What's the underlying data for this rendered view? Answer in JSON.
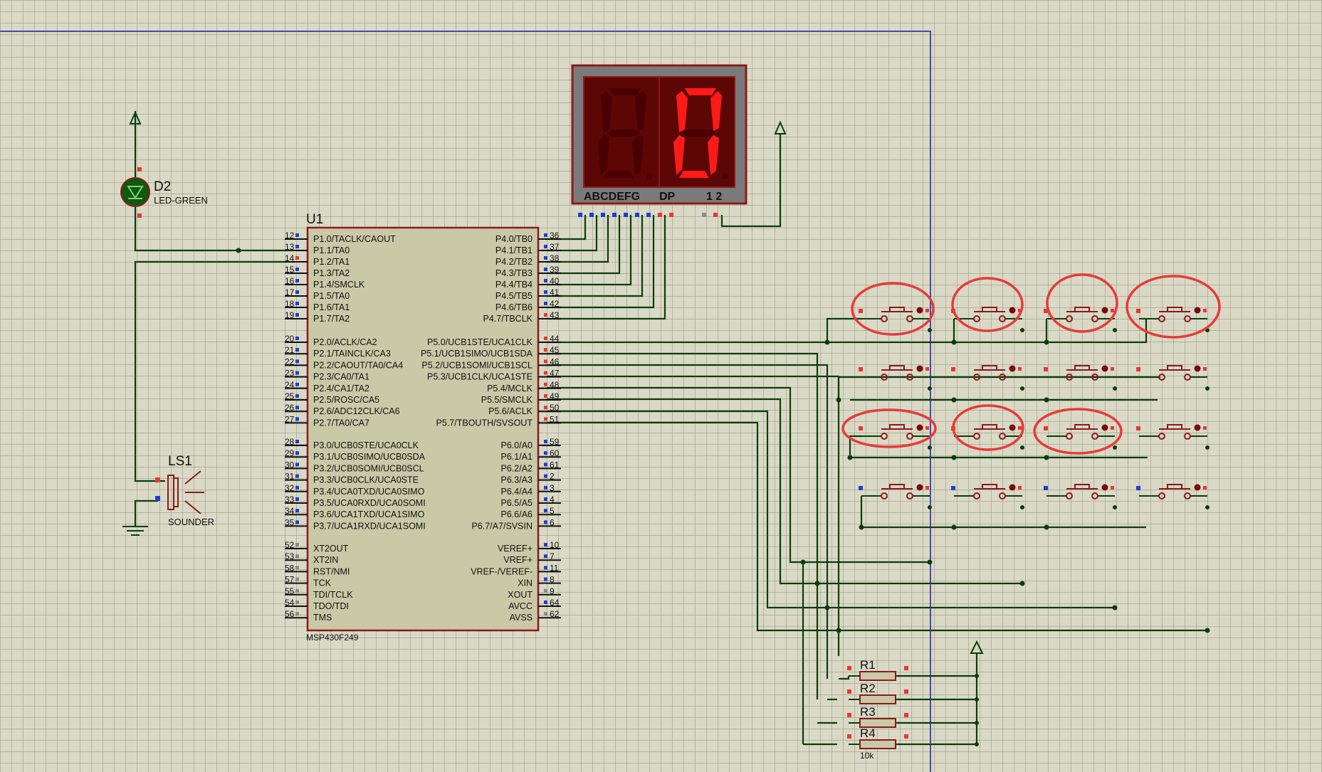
{
  "u1": {
    "ref": "U1",
    "part": "MSP430F249",
    "left_pins": [
      {
        "n": "12",
        "label": "P1.0/TACLK/CAOUT"
      },
      {
        "n": "13",
        "label": "P1.1/TA0"
      },
      {
        "n": "14",
        "label": "P1.2/TA1"
      },
      {
        "n": "15",
        "label": "P1.3/TA2"
      },
      {
        "n": "16",
        "label": "P1.4/SMCLK"
      },
      {
        "n": "17",
        "label": "P1.5/TA0"
      },
      {
        "n": "18",
        "label": "P1.6/TA1"
      },
      {
        "n": "19",
        "label": "P1.7/TA2"
      },
      {
        "n": "20",
        "label": "P2.0/ACLK/CA2"
      },
      {
        "n": "21",
        "label": "P2.1/TAINCLK/CA3"
      },
      {
        "n": "22",
        "label": "P2.2/CAOUT/TA0/CA4"
      },
      {
        "n": "23",
        "label": "P2.3/CA0/TA1"
      },
      {
        "n": "24",
        "label": "P2.4/CA1/TA2"
      },
      {
        "n": "25",
        "label": "P2.5/ROSC/CA5"
      },
      {
        "n": "26",
        "label": "P2.6/ADC12CLK/CA6"
      },
      {
        "n": "27",
        "label": "P2.7/TA0/CA7"
      },
      {
        "n": "28",
        "label": "P3.0/UCB0STE/UCA0CLK"
      },
      {
        "n": "29",
        "label": "P3.1/UCB0SIMO/UCB0SDA"
      },
      {
        "n": "30",
        "label": "P3.2/UCB0SOMI/UCB0SCL"
      },
      {
        "n": "31",
        "label": "P3.3/UCB0CLK/UCA0STE"
      },
      {
        "n": "32",
        "label": "P3.4/UCA0TXD/UCA0SIMO"
      },
      {
        "n": "33",
        "label": "P3.5/UCA0RXD/UCA0SOMI"
      },
      {
        "n": "34",
        "label": "P3.6/UCA1TXD/UCA1SIMO"
      },
      {
        "n": "35",
        "label": "P3.7/UCA1RXD/UCA1SOMI"
      },
      {
        "n": "52",
        "label": "XT2OUT"
      },
      {
        "n": "53",
        "label": "XT2IN"
      },
      {
        "n": "58",
        "label": "RST/NMI"
      },
      {
        "n": "57",
        "label": "TCK"
      },
      {
        "n": "55",
        "label": "TDI/TCLK"
      },
      {
        "n": "54",
        "label": "TDO/TDI"
      },
      {
        "n": "56",
        "label": "TMS"
      }
    ],
    "right_pins": [
      {
        "n": "36",
        "label": "P4.0/TB0"
      },
      {
        "n": "37",
        "label": "P4.1/TB1"
      },
      {
        "n": "38",
        "label": "P4.2/TB2"
      },
      {
        "n": "39",
        "label": "P4.3/TB3"
      },
      {
        "n": "40",
        "label": "P4.4/TB4"
      },
      {
        "n": "41",
        "label": "P4.5/TB5"
      },
      {
        "n": "42",
        "label": "P4.6/TB6"
      },
      {
        "n": "43",
        "label": "P4.7/TBCLK"
      },
      {
        "n": "44",
        "label": "P5.0/UCB1STE/UCA1CLK"
      },
      {
        "n": "45",
        "label": "P5.1/UCB1SIMO/UCB1SDA"
      },
      {
        "n": "46",
        "label": "P5.2/UCB1SOMI/UCB1SCL"
      },
      {
        "n": "47",
        "label": "P5.3/UCB1CLK/UCA1STE"
      },
      {
        "n": "48",
        "label": "P5.4/MCLK"
      },
      {
        "n": "49",
        "label": "P5.5/SMCLK"
      },
      {
        "n": "50",
        "label": "P5.6/ACLK"
      },
      {
        "n": "51",
        "label": "P5.7/TBOUTH/SVSOUT"
      },
      {
        "n": "59",
        "label": "P6.0/A0"
      },
      {
        "n": "60",
        "label": "P6.1/A1"
      },
      {
        "n": "61",
        "label": "P6.2/A2"
      },
      {
        "n": "2",
        "label": "P6.3/A3"
      },
      {
        "n": "3",
        "label": "P6.4/A4"
      },
      {
        "n": "4",
        "label": "P6.5/A5"
      },
      {
        "n": "5",
        "label": "P6.6/A6"
      },
      {
        "n": "6",
        "label": "P6.7/A7/SVSIN"
      },
      {
        "n": "10",
        "label": "VEREF+"
      },
      {
        "n": "7",
        "label": "VREF+"
      },
      {
        "n": "11",
        "label": "VREF-/VEREF-"
      },
      {
        "n": "8",
        "label": "XIN"
      },
      {
        "n": "9",
        "label": "XOUT"
      },
      {
        "n": "64",
        "label": "AVCC"
      },
      {
        "n": "62",
        "label": "AVSS"
      }
    ]
  },
  "d2": {
    "ref": "D2",
    "part": "LED-GREEN"
  },
  "ls1": {
    "ref": "LS1",
    "part": "SOUNDER"
  },
  "display": {
    "segments": "ABCDEFG",
    "dp": "DP",
    "digits": "1 2",
    "digit2_value": "0"
  },
  "resistors": [
    {
      "ref": "R1"
    },
    {
      "ref": "R2"
    },
    {
      "ref": "R3"
    },
    {
      "ref": "R4",
      "value": "10k"
    }
  ],
  "colors": {
    "wire": "#0b3d0b",
    "body_outline": "#8b1a1a",
    "chip_fill": "#c9c9a8",
    "segment_on": "#ff1a1a",
    "segment_off": "#4a0000",
    "highlight": "#e83a3a",
    "sheet_border": "#1a1aa8"
  }
}
